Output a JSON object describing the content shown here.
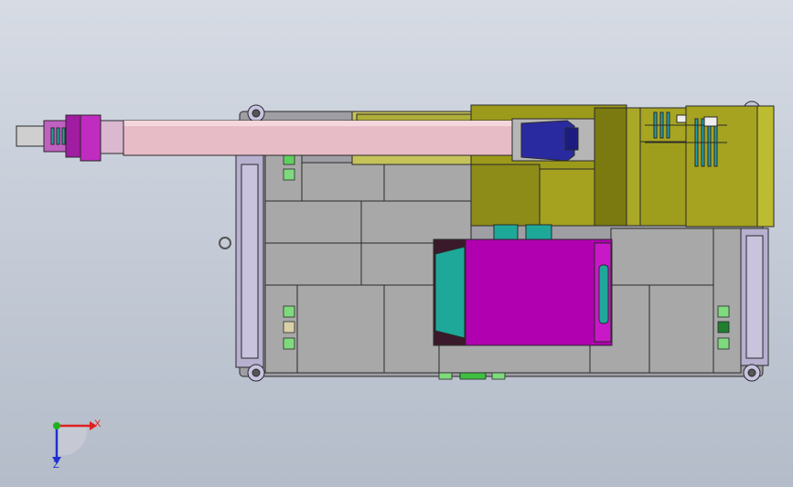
{
  "scene": {
    "background_top": "#d6dbe4",
    "background_bottom": "#b4bcc9",
    "colors": {
      "chassis_gray": "#a9a9a9",
      "boom_pink": "#e8bcc6",
      "olive": "#9c9a1a",
      "magenta": "#b000b0",
      "teal": "#1ea89a",
      "navy": "#202090",
      "outline": "#2a2a2a",
      "light_green": "#7fd97f"
    }
  },
  "triad": {
    "x_label": "X",
    "z_label": "Z",
    "x_color": "#e02020",
    "y_color": "#20b020",
    "z_color": "#2030d0"
  }
}
